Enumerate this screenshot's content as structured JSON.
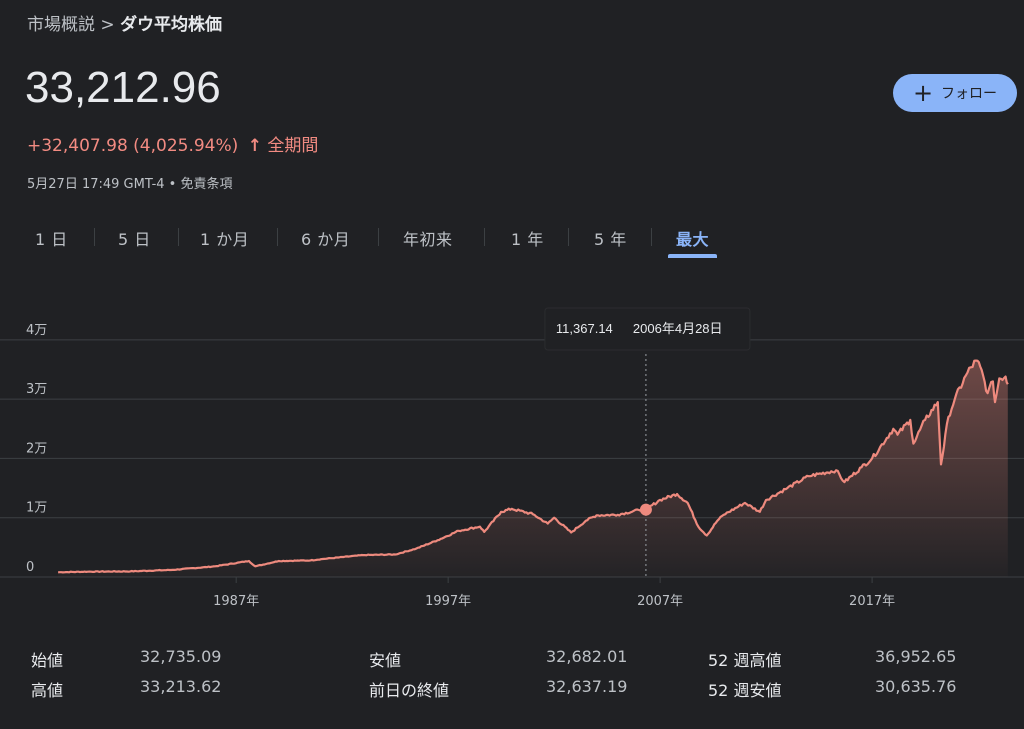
{
  "breadcrumb": {
    "parent": "市場概説",
    "separator": ">",
    "current": "ダウ平均株価"
  },
  "quote": {
    "price": "33,212.96",
    "change": "+32,407.98 (4,025.94%)",
    "period": "全期間",
    "timestamp": "5月27日 17:49 GMT-4 • 免責条項",
    "arrow_icon": "arrow-up-icon"
  },
  "follow_button": {
    "label": "フォロー",
    "icon": "plus-icon"
  },
  "range_tabs": [
    {
      "label": "1 日",
      "active": false
    },
    {
      "label": "5 日",
      "active": false
    },
    {
      "label": "1 か月",
      "active": false
    },
    {
      "label": "6 か月",
      "active": false
    },
    {
      "label": "年初来",
      "active": false
    },
    {
      "label": "1 年",
      "active": false
    },
    {
      "label": "5 年",
      "active": false
    },
    {
      "label": "最大",
      "active": true
    }
  ],
  "colors": {
    "line": "#ee8a7e",
    "accent": "#8ab4f8",
    "negative_red": "#f28b82",
    "background": "#202124",
    "grid": "#3c4043"
  },
  "chart_data": {
    "type": "area",
    "x_unit": "year",
    "ylim": [
      0,
      42000
    ],
    "xlim": [
      1978.5,
      2023.6
    ],
    "y_ticks": [
      {
        "value": 0,
        "label": "0"
      },
      {
        "value": 10000,
        "label": "1万"
      },
      {
        "value": 20000,
        "label": "2万"
      },
      {
        "value": 30000,
        "label": "3万"
      },
      {
        "value": 40000,
        "label": "4万"
      }
    ],
    "x_ticks": [
      {
        "value": 1987,
        "label": "1987年"
      },
      {
        "value": 1997,
        "label": "1997年"
      },
      {
        "value": 2007,
        "label": "2007年"
      },
      {
        "value": 2017,
        "label": "2017年"
      }
    ],
    "grid": true,
    "series": [
      {
        "points": [
          [
            1978.6,
            800
          ],
          [
            1980,
            900
          ],
          [
            1982,
            950
          ],
          [
            1984,
            1200
          ],
          [
            1986,
            1800
          ],
          [
            1987.6,
            2700
          ],
          [
            1987.9,
            1800
          ],
          [
            1989,
            2700
          ],
          [
            1990.5,
            2800
          ],
          [
            1991,
            3000
          ],
          [
            1993,
            3700
          ],
          [
            1994.5,
            3800
          ],
          [
            1995.5,
            4800
          ],
          [
            1996.5,
            6200
          ],
          [
            1997.5,
            7800
          ],
          [
            1998.5,
            8500
          ],
          [
            1998.7,
            7600
          ],
          [
            1999.5,
            11000
          ],
          [
            2000,
            11500
          ],
          [
            2001,
            10600
          ],
          [
            2001.7,
            9000
          ],
          [
            2002,
            10000
          ],
          [
            2002.8,
            7500
          ],
          [
            2003.5,
            9500
          ],
          [
            2004,
            10400
          ],
          [
            2005,
            10500
          ],
          [
            2006,
            11300
          ],
          [
            2006.33,
            11367
          ],
          [
            2007,
            13000
          ],
          [
            2007.8,
            14000
          ],
          [
            2008.3,
            12500
          ],
          [
            2008.8,
            8500
          ],
          [
            2009.2,
            7000
          ],
          [
            2009.7,
            9500
          ],
          [
            2010,
            10500
          ],
          [
            2011,
            12500
          ],
          [
            2011.7,
            11000
          ],
          [
            2012,
            13000
          ],
          [
            2013,
            15000
          ],
          [
            2014,
            17000
          ],
          [
            2015.3,
            18000
          ],
          [
            2015.7,
            16000
          ],
          [
            2016.5,
            18500
          ],
          [
            2017,
            20000
          ],
          [
            2018,
            25000
          ],
          [
            2018.2,
            24000
          ],
          [
            2018.8,
            26500
          ],
          [
            2018.95,
            22500
          ],
          [
            2019.5,
            26500
          ],
          [
            2020.1,
            29500
          ],
          [
            2020.25,
            19000
          ],
          [
            2020.6,
            27000
          ],
          [
            2020.9,
            30000
          ],
          [
            2021.5,
            34500
          ],
          [
            2021.9,
            36500
          ],
          [
            2022.1,
            35500
          ],
          [
            2022.45,
            31000
          ],
          [
            2022.7,
            33000
          ],
          [
            2022.8,
            29500
          ],
          [
            2023,
            33500
          ],
          [
            2023.3,
            33800
          ],
          [
            2023.4,
            32500
          ]
        ]
      }
    ],
    "tooltip": {
      "x": 2006.33,
      "value_label": "11,367.14",
      "date_label": "2006年4月28日"
    }
  },
  "stats": [
    {
      "label": "始値",
      "value": "32,735.09"
    },
    {
      "label": "高値",
      "value": "33,213.62"
    },
    {
      "label": "安値",
      "value": "32,682.01"
    },
    {
      "label": "前日の終値",
      "value": "32,637.19"
    },
    {
      "label": "52 週高値",
      "value": "36,952.65"
    },
    {
      "label": "52 週安値",
      "value": "30,635.76"
    }
  ]
}
